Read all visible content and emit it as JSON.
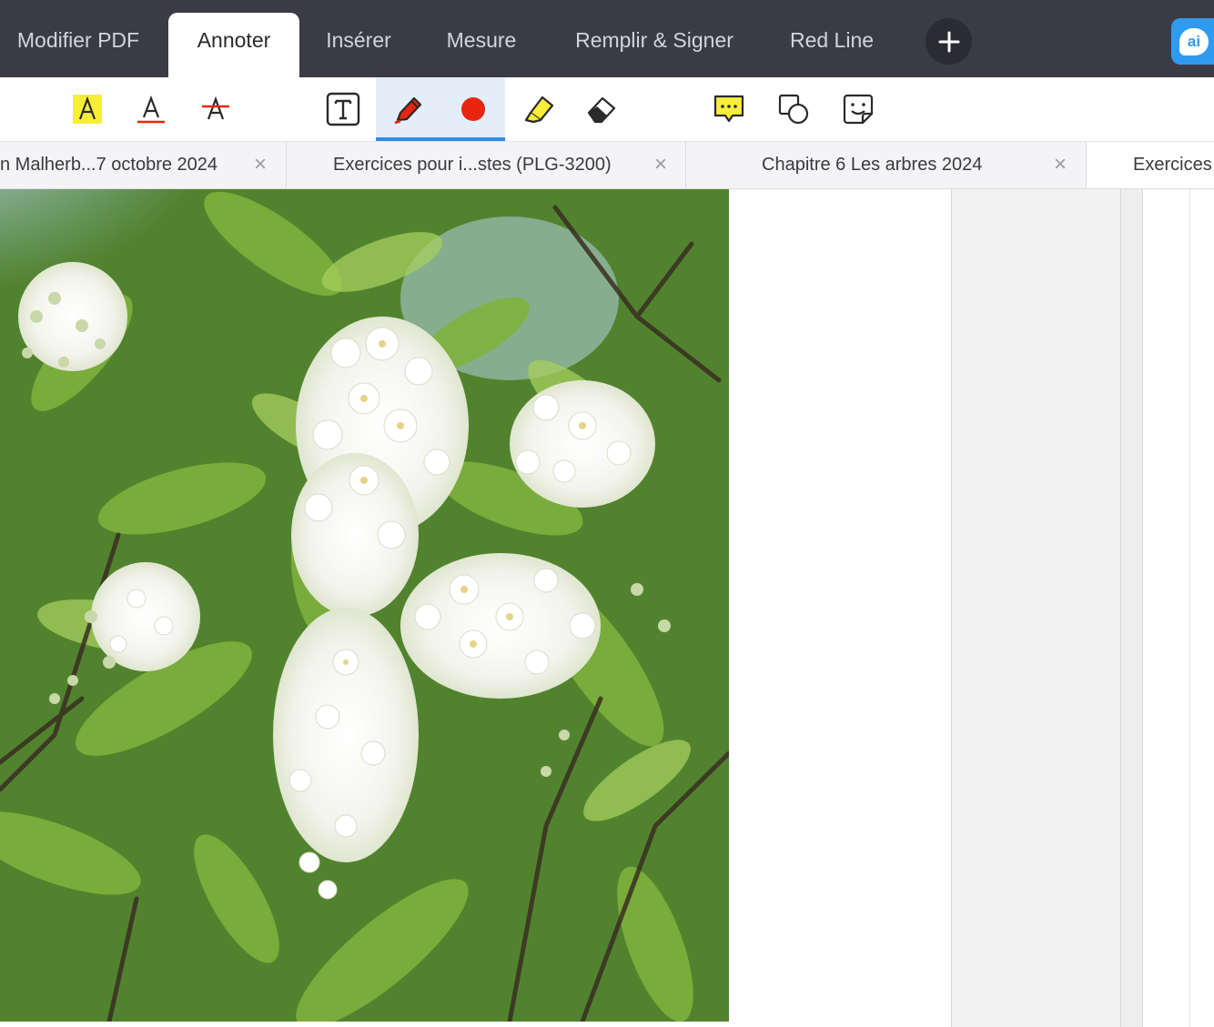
{
  "menu": {
    "tabs": [
      {
        "label": "Modifier PDF"
      },
      {
        "label": "Annoter"
      },
      {
        "label": "Insérer"
      },
      {
        "label": "Mesure"
      },
      {
        "label": "Remplir & Signer"
      },
      {
        "label": "Red Line"
      }
    ],
    "active_tab": "Annoter",
    "ai_label": "ai"
  },
  "toolbar": {
    "tools": [
      {
        "icon": "text-highlight-icon"
      },
      {
        "icon": "text-underline-icon"
      },
      {
        "icon": "text-strikethrough-icon"
      },
      {
        "icon": "text-box-icon"
      },
      {
        "icon": "pen-icon",
        "selected": true
      },
      {
        "icon": "color-dot-icon",
        "color": "#e8260f"
      },
      {
        "icon": "highlighter-icon"
      },
      {
        "icon": "eraser-icon"
      },
      {
        "icon": "comment-icon"
      },
      {
        "icon": "shapes-icon"
      },
      {
        "icon": "sticker-icon"
      }
    ]
  },
  "document_tabs": [
    {
      "title": "n Malherb...7 octobre 2024",
      "close": "×"
    },
    {
      "title": "Exercices pour i...stes (PLG-3200)",
      "close": "×"
    },
    {
      "title": "Chapitre 6 Les arbres  2024",
      "close": "×"
    },
    {
      "title": "Exercices"
    }
  ],
  "colors": {
    "menubar": "#3b3b45",
    "accent": "#2f8ce8",
    "ai_button": "#2f9bf0",
    "pen_red": "#e8260f",
    "highlight_yellow": "#f8ee3a"
  }
}
